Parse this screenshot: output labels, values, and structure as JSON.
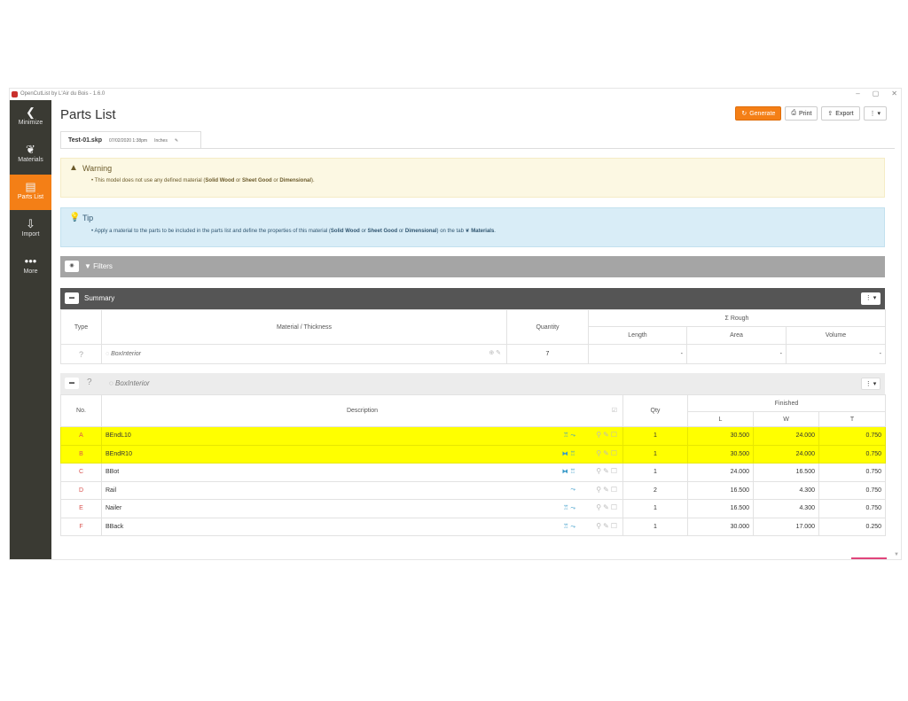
{
  "window": {
    "title": "OpenCutList by L'Air du Bois - 1.6.0"
  },
  "sidebar": {
    "items": [
      {
        "label": "Minimize",
        "icon": "chevron-left-icon",
        "glyph": "❮"
      },
      {
        "label": "Materials",
        "icon": "materials-icon",
        "glyph": "❦"
      },
      {
        "label": "Parts List",
        "icon": "list-icon",
        "glyph": "▤"
      },
      {
        "label": "Import",
        "icon": "import-icon",
        "glyph": "⇩"
      },
      {
        "label": "More",
        "icon": "more-icon",
        "glyph": "•••"
      }
    ]
  },
  "header": {
    "title": "Parts List",
    "buttons": {
      "generate": "Generate",
      "print": "Print",
      "export": "Export"
    }
  },
  "file_tab": {
    "name": "Test-01.skp",
    "date": "07/02/2020 1:38pm",
    "units": "Inches"
  },
  "warning": {
    "title": "Warning",
    "text_before": "This model does not use any defined material (",
    "solid_wood": "Solid Wood",
    "or1": "or",
    "sheet_good": "Sheet Good",
    "or2": "or",
    "dimensional": "Dimensional",
    "text_after": ")."
  },
  "tip": {
    "title": "Tip",
    "text_before": "Apply a material to the parts to be included in the parts list and define the properties of this material (",
    "solid_wood": "Solid Wood",
    "or1": "or",
    "sheet_good": "Sheet Good",
    "or2": "or",
    "dimensional": "Dimensional",
    "text_after": ") on the tab",
    "materials": "Materials",
    "end": "."
  },
  "filters": {
    "label": "Filters"
  },
  "summary": {
    "label": "Summary",
    "headers": {
      "type": "Type",
      "material": "Material / Thickness",
      "quantity": "Quantity",
      "rough": "Σ Rough",
      "length": "Length",
      "area": "Area",
      "volume": "Volume"
    },
    "rows": [
      {
        "type": "?",
        "material": "BoxInterior",
        "quantity": "7",
        "length": "-",
        "area": "-",
        "volume": "-"
      }
    ]
  },
  "group": {
    "name": "BoxInterior",
    "type": "?"
  },
  "parts": {
    "headers": {
      "no": "No.",
      "description": "Description",
      "qty": "Qty",
      "finished": "Finished",
      "l": "L",
      "w": "W",
      "t": "T"
    },
    "rows": [
      {
        "no": "A",
        "description": "BEndL10",
        "qty": "1",
        "l": "30.500",
        "w": "24.000",
        "t": "0.750",
        "highlight": true
      },
      {
        "no": "B",
        "description": "BEndR10",
        "qty": "1",
        "l": "30.500",
        "w": "24.000",
        "t": "0.750",
        "highlight": true
      },
      {
        "no": "C",
        "description": "BBot",
        "qty": "1",
        "l": "24.000",
        "w": "16.500",
        "t": "0.750",
        "highlight": false
      },
      {
        "no": "D",
        "description": "Rail",
        "qty": "2",
        "l": "16.500",
        "w": "4.300",
        "t": "0.750",
        "highlight": false
      },
      {
        "no": "E",
        "description": "Nailer",
        "qty": "1",
        "l": "16.500",
        "w": "4.300",
        "t": "0.750",
        "highlight": false
      },
      {
        "no": "F",
        "description": "BBack",
        "qty": "1",
        "l": "30.000",
        "w": "17.000",
        "t": "0.250",
        "highlight": false
      }
    ]
  },
  "colors": {
    "accent": "#f47f16",
    "sidebar": "#3a3a33",
    "highlight": "#ffff00"
  }
}
